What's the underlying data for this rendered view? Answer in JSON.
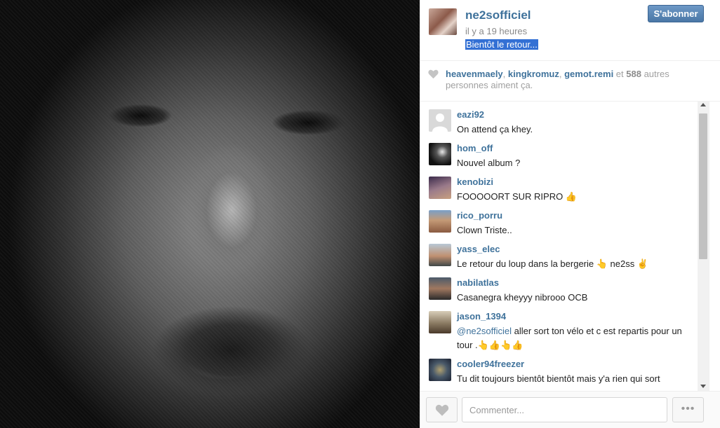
{
  "post": {
    "author": "ne2sofficiel",
    "time_ago": "il y a 19 heures",
    "caption": "Bientôt le retour...",
    "follow_label": "S'abonner"
  },
  "likes": {
    "users": [
      "heavenmaely",
      "kingkromuz",
      "gemot.remi"
    ],
    "sep1": ", ",
    "sep2": ", ",
    "and_word": " et ",
    "count": "588",
    "suffix": " autres personnes aiment ça."
  },
  "comments": [
    {
      "user": "eazi92",
      "text": "On attend ça khey.",
      "avatar": "#d9d9d9"
    },
    {
      "user": "hom_off",
      "text": "Nouvel album ?",
      "avatar": "#1c1c1c"
    },
    {
      "user": "kenobizi",
      "text": "FOOOOORT SUR RIPRO 👍",
      "avatar": "#7a6a7e"
    },
    {
      "user": "rico_porru",
      "text": "Clown Triste..",
      "avatar": "#b08a6a"
    },
    {
      "user": "yass_elec",
      "text": "Le retour du loup dans la bergerie 👆 ne2ss ✌",
      "avatar": "#8aa0b4"
    },
    {
      "user": "nabilatlas",
      "text": "Casanegra kheyyy nibrooo OCB",
      "avatar": "#6a5a52"
    },
    {
      "user": "jason_1394",
      "mention": "@ne2sofficiel",
      "text": " aller sort ton vélo et c est repartis pour un tour .👆👍👆👍",
      "avatar": "#b6a48a"
    },
    {
      "user": "cooler94freezer",
      "text": "Tu dit toujours bientôt bientôt mais y'a rien qui sort",
      "avatar": "#3c4a5a"
    }
  ],
  "footer": {
    "comment_placeholder": "Commenter...",
    "more_label": "•••"
  },
  "icons": {
    "like_heart": "heart-icon",
    "more": "ellipsis-icon"
  },
  "colors": {
    "link": "#3f729b",
    "follow_button": "#4a77a6",
    "caption_highlight": "#3370d4"
  }
}
